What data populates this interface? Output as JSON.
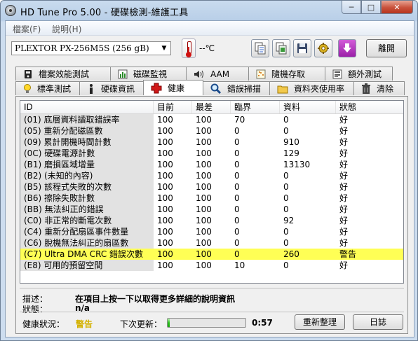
{
  "window": {
    "title": "HD Tune Pro  5.00 - 硬碟檢測-維護工具"
  },
  "menu": {
    "file": "檔案(F)",
    "help": "說明(H)"
  },
  "toolbar": {
    "drive": "PLEXTOR PX-256M5S (256 gB)",
    "temperature": "--℃",
    "exit_label": "離開",
    "icons": [
      "copy-text-icon",
      "copy-screenshot-icon",
      "save-icon",
      "options-icon",
      "download-icon"
    ]
  },
  "tabs_top": [
    {
      "label": "檔案效能測試",
      "icon": "file-benchmark-icon"
    },
    {
      "label": "磁碟監視",
      "icon": "disk-monitor-icon"
    },
    {
      "label": "AAM",
      "icon": "speaker-icon"
    },
    {
      "label": "隨機存取",
      "icon": "random-access-icon"
    },
    {
      "label": "額外測試",
      "icon": "extra-tests-icon"
    }
  ],
  "tabs_bottom": [
    {
      "label": "標準測試",
      "icon": "bulb-icon"
    },
    {
      "label": "硬碟資訊",
      "icon": "info-icon"
    },
    {
      "label": "健康",
      "icon": "health-cross-icon",
      "active": true
    },
    {
      "label": "錯誤掃描",
      "icon": "magnifier-icon"
    },
    {
      "label": "資料夾使用率",
      "icon": "folder-icon"
    },
    {
      "label": "清除",
      "icon": "trash-icon"
    }
  ],
  "table": {
    "columns": [
      "ID",
      "目前",
      "最差",
      "臨界",
      "資料",
      "狀態"
    ],
    "rows": [
      [
        "(01) 底層資料讀取錯誤率",
        "100",
        "100",
        "70",
        "0",
        "好"
      ],
      [
        "(05) 重新分配磁區數",
        "100",
        "100",
        "0",
        "0",
        "好"
      ],
      [
        "(09) 累計開機時間計數",
        "100",
        "100",
        "0",
        "910",
        "好"
      ],
      [
        "(0C) 硬碟電源計數",
        "100",
        "100",
        "0",
        "129",
        "好"
      ],
      [
        "(B1) 磨損區域增量",
        "100",
        "100",
        "0",
        "13130",
        "好"
      ],
      [
        "(B2) (未知的內容)",
        "100",
        "100",
        "0",
        "0",
        "好"
      ],
      [
        "(B5) 該程式失敗的次數",
        "100",
        "100",
        "0",
        "0",
        "好"
      ],
      [
        "(B6) 擦除失敗計數",
        "100",
        "100",
        "0",
        "0",
        "好"
      ],
      [
        "(BB) 無法糾正的錯誤",
        "100",
        "100",
        "0",
        "0",
        "好"
      ],
      [
        "(C0) 非正常的斷電次數",
        "100",
        "100",
        "0",
        "92",
        "好"
      ],
      [
        "(C4) 重新分配扇區事件數量",
        "100",
        "100",
        "0",
        "0",
        "好"
      ],
      [
        "(C6) 脫機無法糾正的扇區數",
        "100",
        "100",
        "0",
        "0",
        "好"
      ],
      [
        "(C7) Ultra DMA CRC 錯誤次數",
        "100",
        "100",
        "0",
        "260",
        "警告"
      ],
      [
        "(E8) 可用的預留空間",
        "100",
        "100",
        "10",
        "0",
        "好"
      ]
    ],
    "warning_row_color": "#ffff55"
  },
  "details": {
    "desc_label": "描述：",
    "desc_value": "在項目上按一下以取得更多詳細的說明資訊",
    "state_label": "狀態：",
    "state_value": "n/a"
  },
  "status": {
    "health_label": "健康狀況：",
    "health_value": "警告",
    "health_color": "#d4b100",
    "next_update_label": "下次更新：",
    "progress_fraction": 0.03,
    "next_update_time": "0:57",
    "refresh_label": "重新整理",
    "log_label": "日誌"
  }
}
